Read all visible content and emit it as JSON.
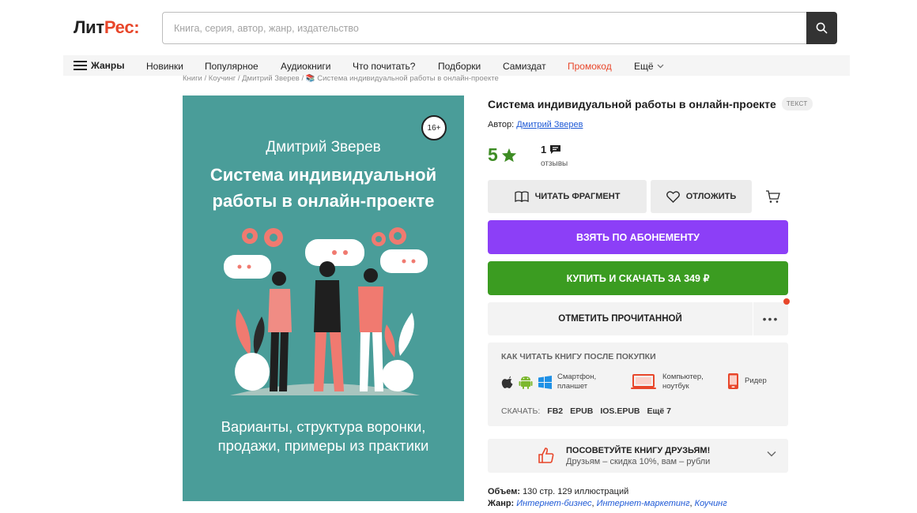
{
  "header": {
    "logo_main": "Лит",
    "logo_accent": "Рес:",
    "search_placeholder": "Книга, серия, автор, жанр, издательство",
    "search_icon": "search-icon"
  },
  "nav": {
    "genres": "Жанры",
    "items": [
      "Новинки",
      "Популярное",
      "Аудиокниги",
      "Что почитать?",
      "Подборки",
      "Самиздат",
      "Промокод",
      "Ещё"
    ]
  },
  "breadcrumb": "Книги / Коучинг / Дмитрий Зверев / 📚 Система индивидуальной работы в онлайн-проекте",
  "cover": {
    "age": "16+",
    "author": "Дмитрий Зверев",
    "title_line1": "Система индивидуальной",
    "title_line2": "работы в онлайн-проекте",
    "subtitle_line1": "Варианты, структура воронки,",
    "subtitle_line2": "продажи, примеры из практики",
    "bg_color": "#4a9d99"
  },
  "book": {
    "title": "Система индивидуальной работы в онлайн-проекте",
    "type_tag": "ТЕКСТ",
    "author_label": "Автор:",
    "author_name": "Дмитрий Зверев",
    "rating": "5",
    "reviews_count": "1",
    "reviews_label": "отзывы"
  },
  "actions": {
    "read_fragment": "Читать фрагмент",
    "save_later": "Отложить",
    "subscribe": "Взять по абонементу",
    "buy": "Купить и скачать за 349 ₽",
    "mark_read": "Отметить прочитанной",
    "more": "•••",
    "subscribe_color": "#8c3ff7",
    "buy_color": "#3b9c21"
  },
  "how_to_read": {
    "title": "Как читать книгу после покупки",
    "smartphone_line1": "Смартфон,",
    "smartphone_line2": "планшет",
    "computer_line1": "Компьютер,",
    "computer_line2": "ноутбук",
    "reader": "Ридер",
    "download_label": "СКАЧАТЬ:",
    "formats": [
      "FB2",
      "EPUB",
      "IOS.EPUB",
      "Ещё 7"
    ]
  },
  "recommend": {
    "title": "Посоветуйте книгу друзьям!",
    "subtitle": "Друзьям – скидка 10%, вам – рубли"
  },
  "meta": {
    "volume_label": "Объем:",
    "volume_value": "130 стр. 129 иллюстраций",
    "genre_label": "Жанр:",
    "genres": [
      "Интернет-бизнес",
      "Интернет-маркетинг",
      "Коучинг"
    ]
  }
}
